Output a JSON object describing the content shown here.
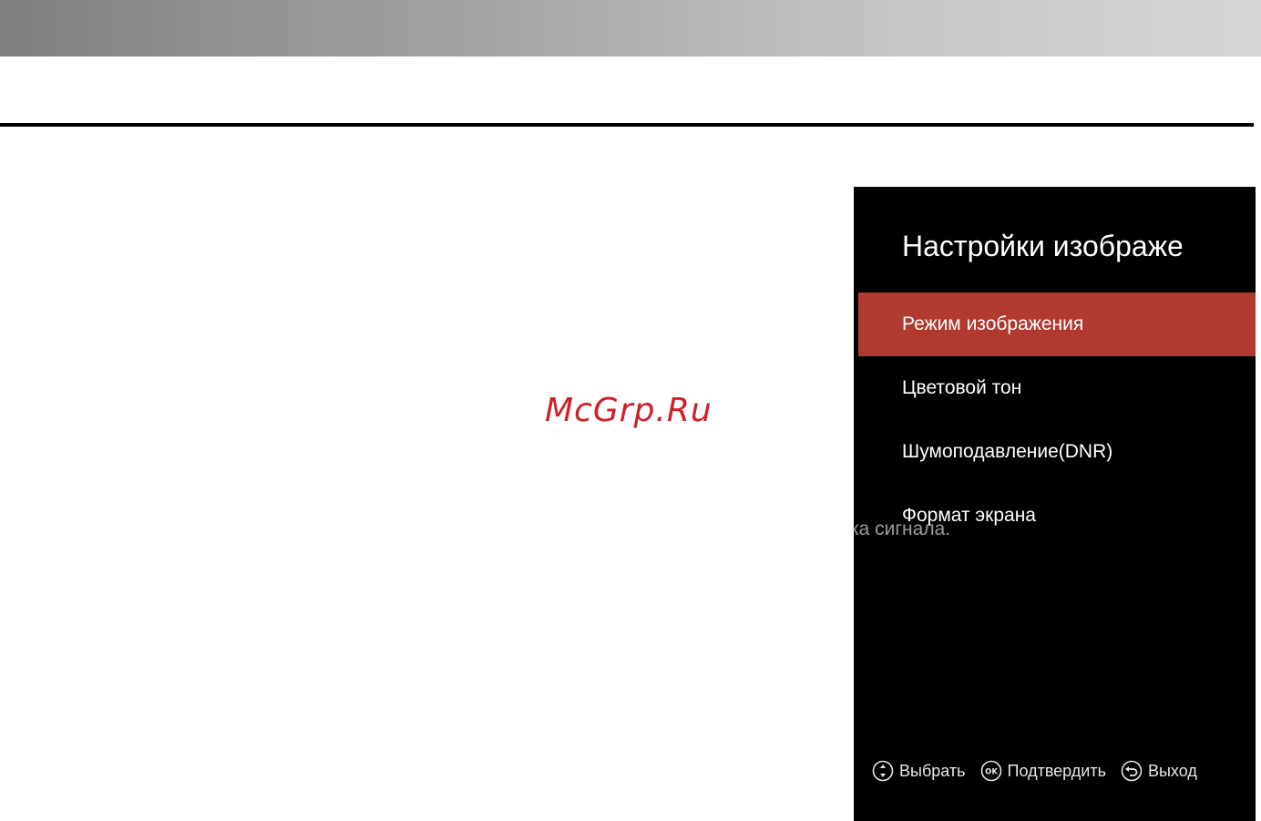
{
  "watermark": "McGrp.Ru",
  "tv_panel": {
    "title": "Настройки изображения",
    "behind_text": "ка сигнала.",
    "menu_items": [
      {
        "label": "Режим изображения",
        "selected": true
      },
      {
        "label": "Цветовой тон",
        "selected": false
      },
      {
        "label": "Шумоподавление(DNR)",
        "selected": false
      },
      {
        "label": "Формат экрана",
        "selected": false
      }
    ],
    "footer": {
      "select_label": "Выбрать",
      "ok_icon_text": "OK",
      "confirm_label": "Подтвердить",
      "exit_label": "Выход"
    }
  },
  "colors": {
    "selected_item": "#b03a2e",
    "watermark": "#d01f2a",
    "panel_bg": "#000000"
  },
  "icons": [
    "updown-arrows-icon",
    "ok-button-icon",
    "back-arrow-icon"
  ]
}
